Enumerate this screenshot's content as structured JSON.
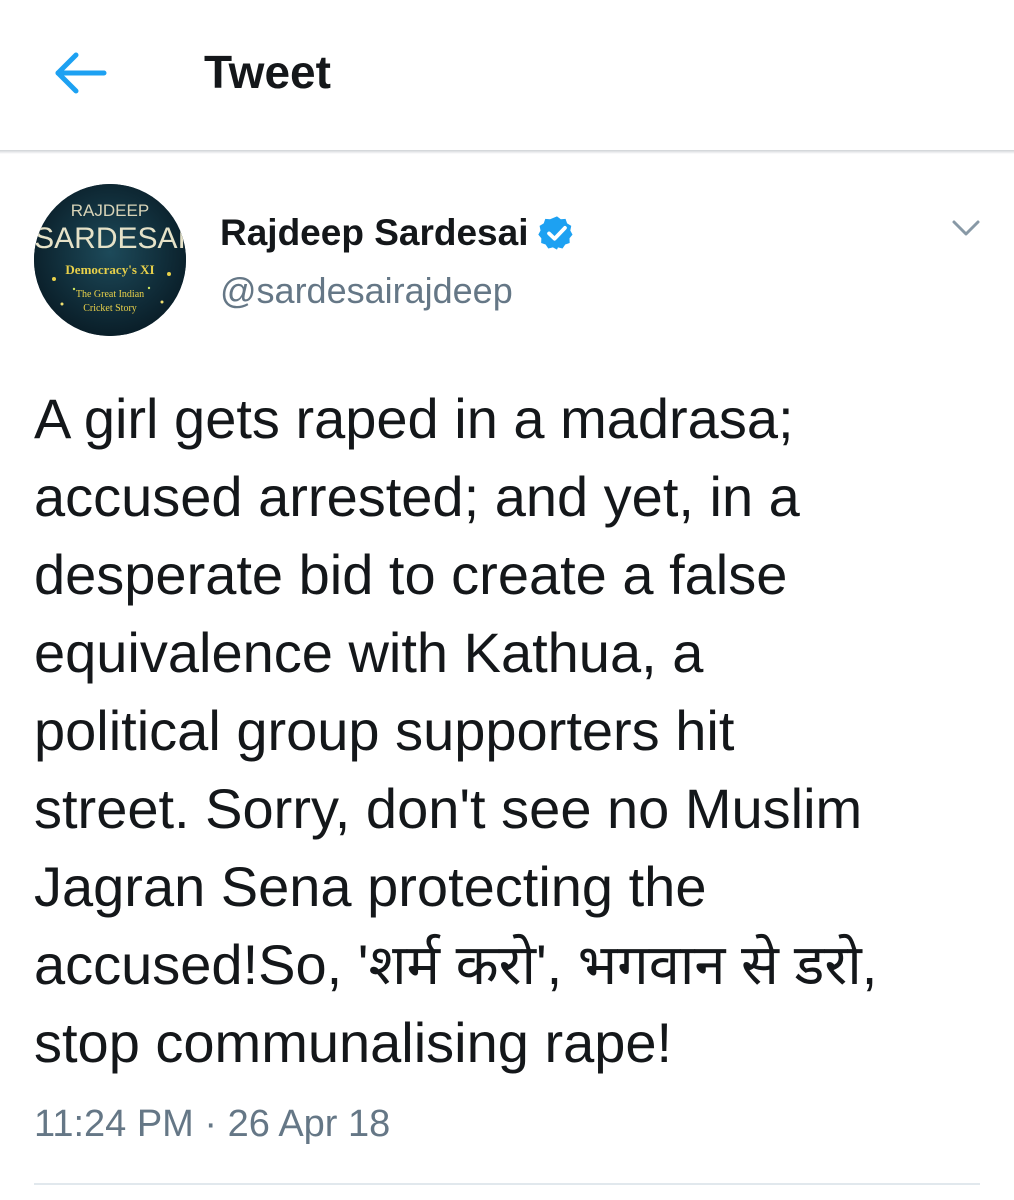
{
  "header": {
    "title": "Tweet",
    "back_icon": "back-arrow-icon"
  },
  "colors": {
    "accent": "#1da1f2",
    "text_primary": "#14171a",
    "text_secondary": "#657786",
    "divider": "#e1e8ed"
  },
  "tweet": {
    "author": {
      "name": "Rajdeep Sardesai",
      "handle": "@sardesairajdeep",
      "verified": true,
      "avatar": {
        "line1": "RAJDEEP",
        "line2": "SARDESAI",
        "line3": "Democracy's XI",
        "line4": "The Great Indian",
        "line5": "Cricket Story"
      }
    },
    "text": "A girl gets raped in a madrasa;\naccused arrested; and yet, in a\ndesperate bid to create a false\nequivalence with Kathua, a\npolitical group supporters hit\nstreet. Sorry, don't see no Muslim\nJagran Sena protecting the\naccused!So, 'शर्म करो', भगवान से डरो,\nstop communalising rape!",
    "timestamp": "11:24 PM · 26 Apr 18"
  }
}
